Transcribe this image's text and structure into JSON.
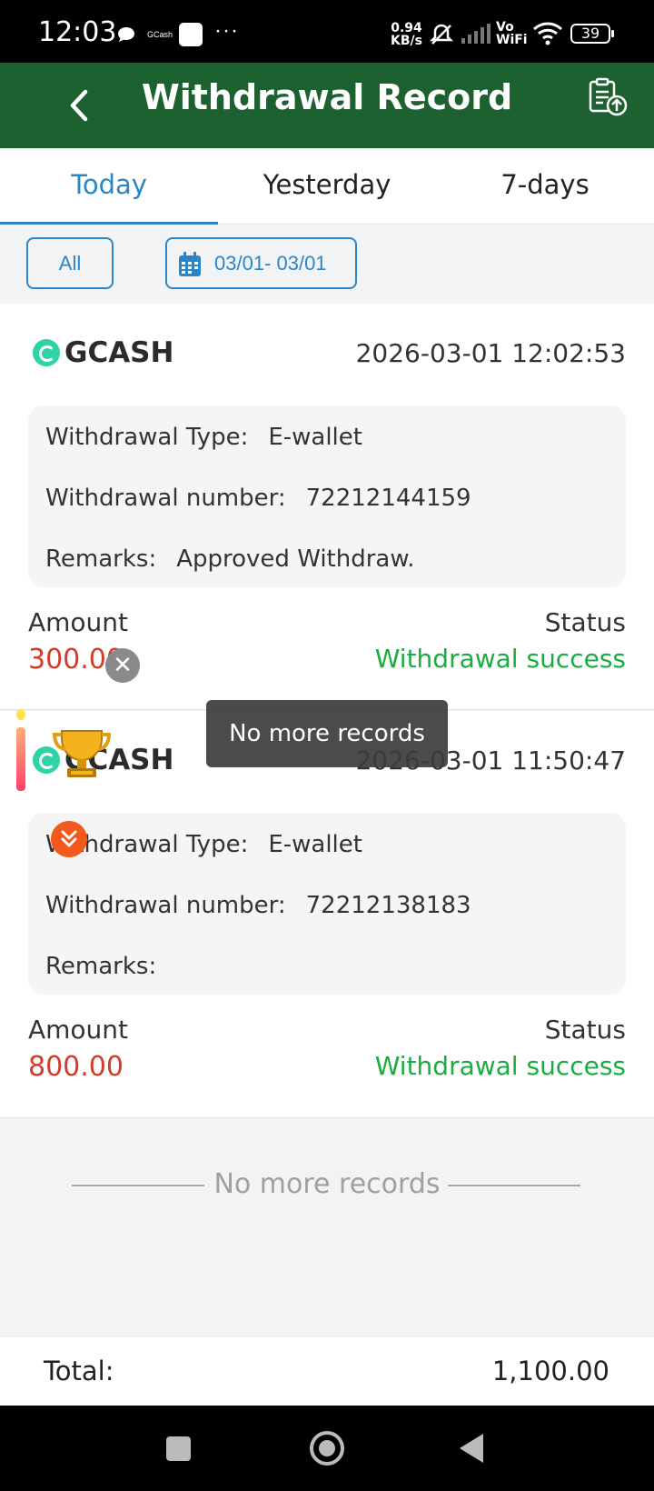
{
  "status_bar": {
    "time": "12:03",
    "notification_label": "GCash",
    "more": "···",
    "speed_value": "0.94",
    "speed_unit": "KB/s",
    "vowifi_top": "Vo",
    "vowifi_bottom": "WiFi",
    "battery": "39"
  },
  "header": {
    "title": "Withdrawal Record"
  },
  "tabs": [
    {
      "label": "Today",
      "active": true
    },
    {
      "label": "Yesterday",
      "active": false
    },
    {
      "label": "7-days",
      "active": false
    }
  ],
  "filters": {
    "all_label": "All",
    "date_range": "03/01- 03/01"
  },
  "records": [
    {
      "brand": "GCASH",
      "time": "2026-03-01 12:02:53",
      "type_label": "Withdrawal Type:",
      "type_value": "E-wallet",
      "number_label": "Withdrawal number:",
      "number_value": "72212144159",
      "remarks_label": "Remarks:",
      "remarks_value": "Approved Withdraw.",
      "amount_label": "Amount",
      "amount_value": "300.00",
      "status_label": "Status",
      "status_value": "Withdrawal success"
    },
    {
      "brand": "GCASH",
      "time": "2026-03-01 11:50:47",
      "type_label": "Withdrawal Type:",
      "type_value": "E-wallet",
      "number_label": "Withdrawal number:",
      "number_value": "72212138183",
      "remarks_label": "Remarks:",
      "remarks_value": "",
      "amount_label": "Amount",
      "amount_value": "800.00",
      "status_label": "Status",
      "status_value": "Withdrawal success"
    }
  ],
  "toast": "No more records",
  "footer": {
    "no_more": "No more records"
  },
  "total": {
    "label": "Total:",
    "value": "1,100.00"
  },
  "colors": {
    "header_bg": "#1e6131",
    "accent": "#2a86c9",
    "amount": "#d43b2a",
    "success": "#1aad3f"
  },
  "icons": [
    "back-arrow-icon",
    "export-record-icon",
    "calendar-icon",
    "gcash-logo-icon",
    "close-icon",
    "trophy-icon",
    "double-chevron-down-icon"
  ]
}
